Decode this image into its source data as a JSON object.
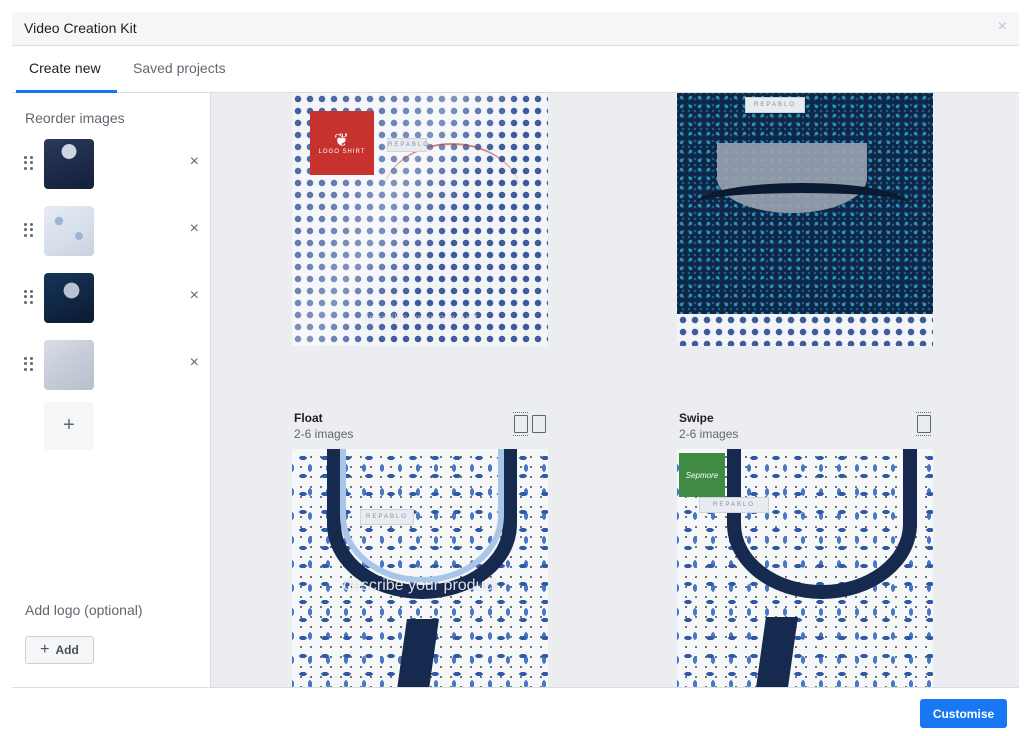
{
  "window": {
    "title": "Video Creation Kit",
    "close_icon": "×"
  },
  "tabs": [
    {
      "label": "Create new",
      "active": true
    },
    {
      "label": "Saved projects",
      "active": false
    }
  ],
  "sidebar": {
    "reorder_title": "Reorder images",
    "images": [
      {
        "name": "navy-shirt-thumbnail",
        "remove_icon": "×"
      },
      {
        "name": "white-print-shirt-thumbnail",
        "remove_icon": "×"
      },
      {
        "name": "dark-navy-shirt-thumbnail",
        "remove_icon": "×"
      },
      {
        "name": "grey-shirt-thumbnail",
        "remove_icon": "×"
      }
    ],
    "add_image_icon": "+",
    "logo_title": "Add logo (optional)",
    "add_logo_button": {
      "icon": "+",
      "label": "Add"
    }
  },
  "templates": [
    {
      "name": "",
      "subtitle": "",
      "overlay_text": "describe your product",
      "logo": "red",
      "logo_text": "LOGO SHIRT"
    },
    {
      "name": "",
      "subtitle": "",
      "overlay_text": ""
    },
    {
      "name": "Float",
      "subtitle": "2-6 images",
      "overlay_text": "describe your product",
      "format_icons": [
        "story-format",
        "portrait-format"
      ]
    },
    {
      "name": "Swipe",
      "subtitle": "2-6 images",
      "overlay_text": "",
      "logo": "green",
      "logo_text": "Sepmore",
      "format_icons": [
        "story-format"
      ]
    }
  ],
  "labels": {
    "brand_tag": "REPABLO"
  },
  "footer": {
    "primary_button": "Customise"
  },
  "colors": {
    "accent": "#1877f2",
    "panel_bg": "#ebedf0",
    "header_bg": "#f5f6f7"
  }
}
